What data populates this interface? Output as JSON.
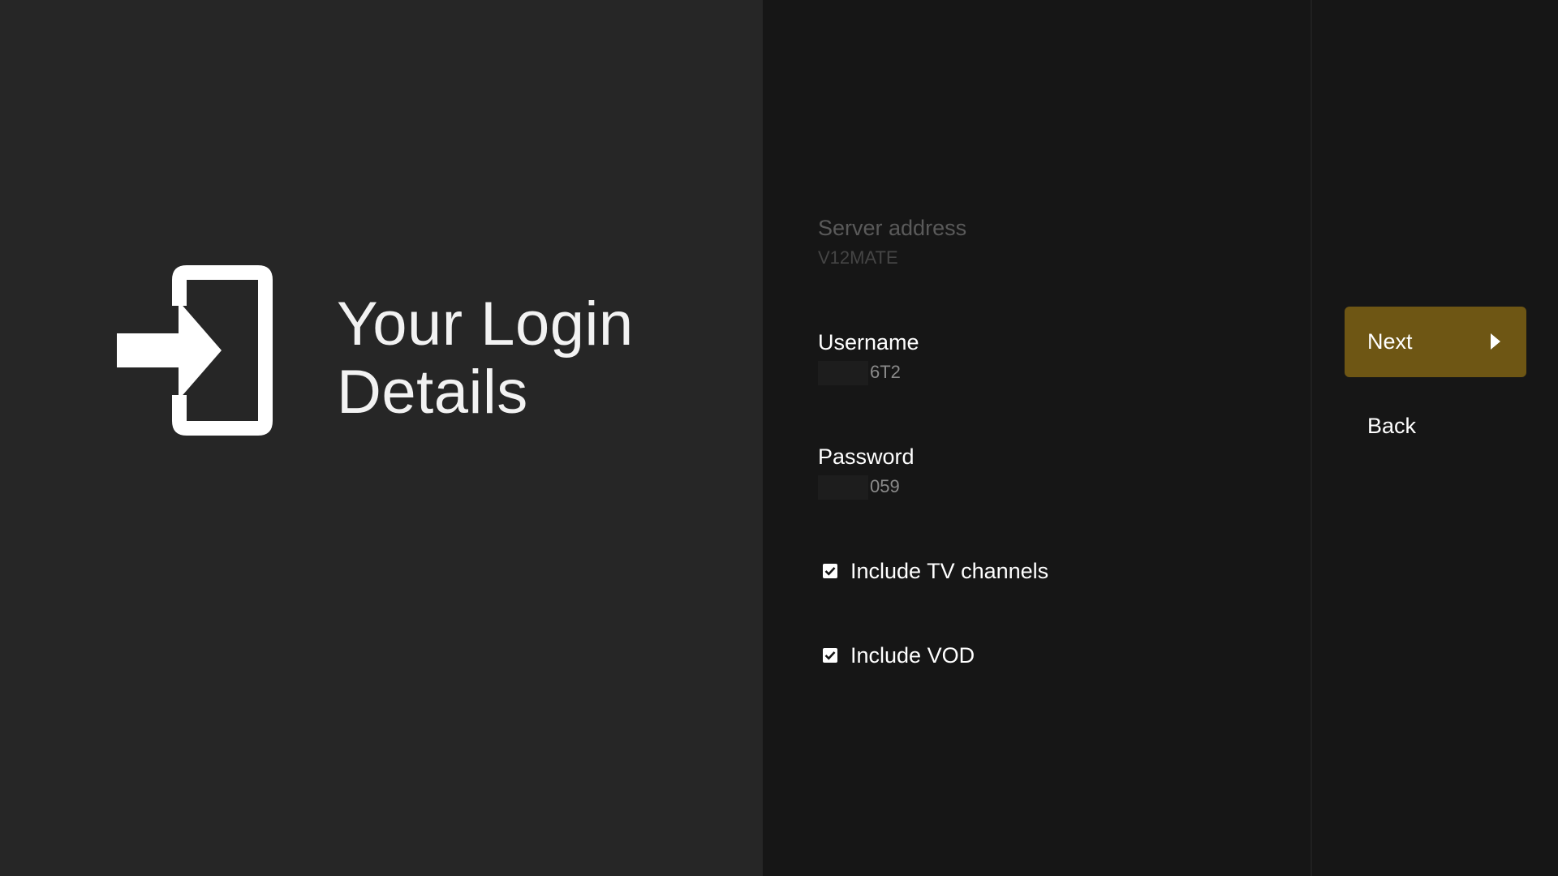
{
  "guidance": {
    "title_line1": "Your Login",
    "title_line2": "Details",
    "icon": "login-icon"
  },
  "form": {
    "server": {
      "label": "Server address",
      "value": "V12MATE",
      "enabled": false
    },
    "username": {
      "label": "Username",
      "value": "6T2"
    },
    "password": {
      "label": "Password",
      "value": "059"
    },
    "include_tv": {
      "label": "Include TV channels",
      "checked": true
    },
    "include_vod": {
      "label": "Include VOD",
      "checked": true
    }
  },
  "actions": {
    "next_label": "Next",
    "back_label": "Back",
    "focused": "next"
  },
  "colors": {
    "accent": "#6e5614",
    "left_pane": "#262626",
    "right_pane": "#161616"
  }
}
